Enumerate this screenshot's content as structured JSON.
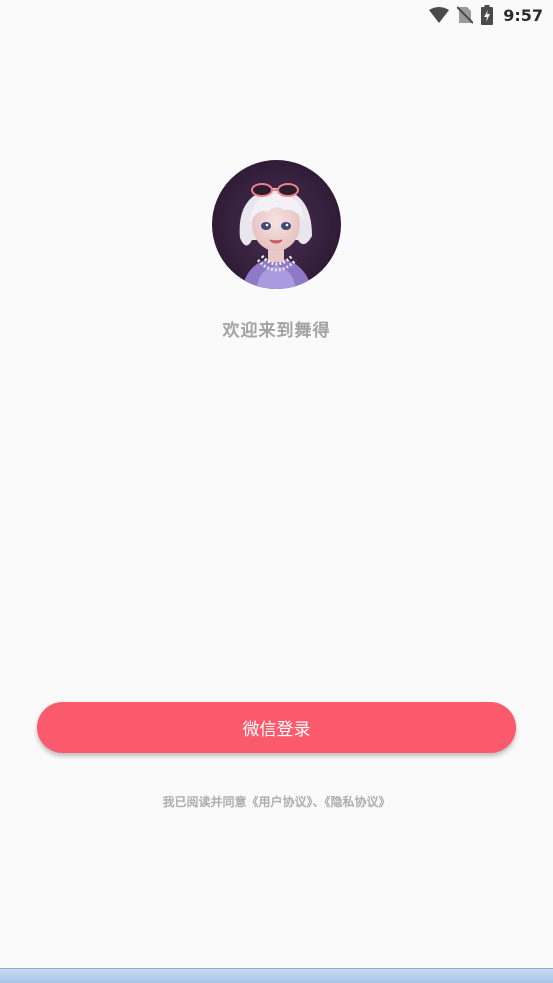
{
  "status_bar": {
    "time": "9:57",
    "icons": [
      "wifi-icon",
      "no-sim-icon",
      "battery-charging-icon"
    ]
  },
  "avatar": {
    "description_icon": "character-avatar"
  },
  "welcome_text": "欢迎来到舞得",
  "login_button": {
    "label": "微信登录",
    "color": "#fb5a6d"
  },
  "agreement": {
    "prefix": "我已阅读并同意",
    "user_agreement": "《用户协议》",
    "separator": "、",
    "privacy_policy": "《隐私协议》"
  }
}
